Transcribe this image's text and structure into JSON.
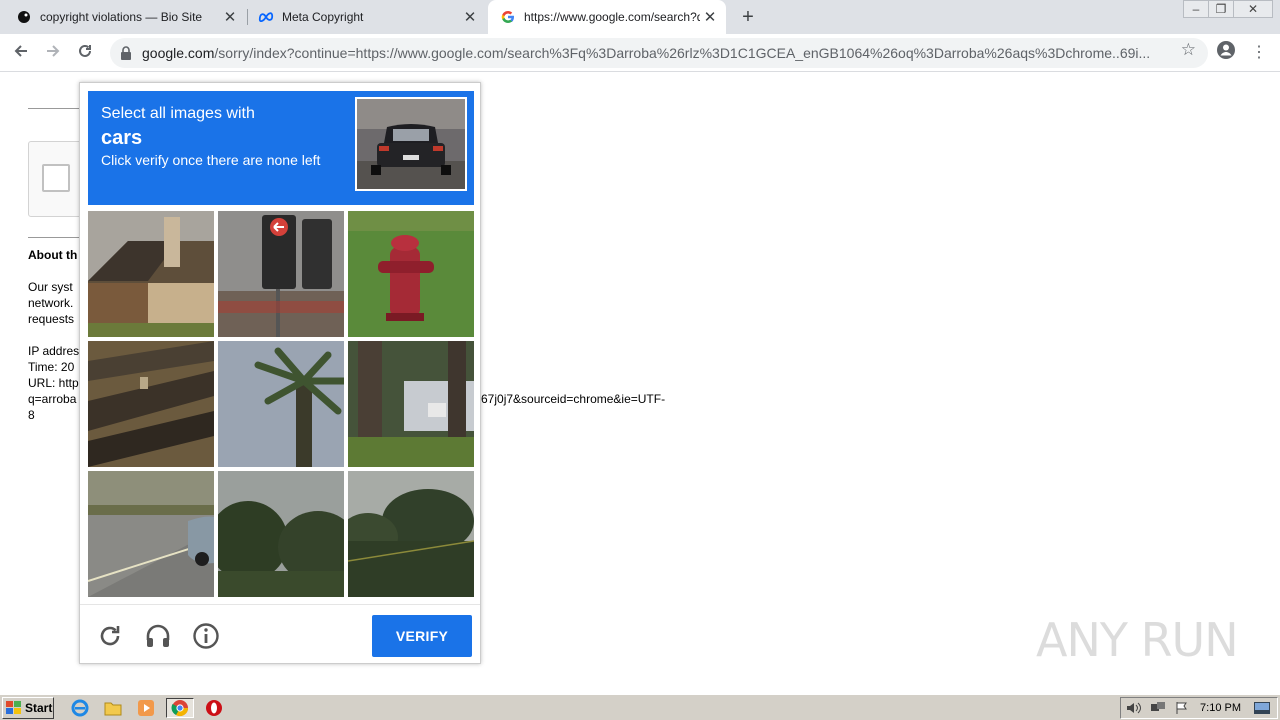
{
  "browser": {
    "tabs": [
      {
        "title": "copyright violations — Bio Site",
        "favicon": "bio-site-icon"
      },
      {
        "title": "Meta Copyright",
        "favicon": "meta-icon"
      },
      {
        "title": "https://www.google.com/search?q=",
        "favicon": "google-icon",
        "active": true
      }
    ],
    "url_host": "google.com",
    "url_path": "/sorry/index?continue=https://www.google.com/search%3Fq%3Darroba%26rlz%3D1C1GCEA_enGB1064%26oq%3Darroba%26aqs%3Dchrome..69i..."
  },
  "page": {
    "about_heading": "About th",
    "para_line1": "Our syst",
    "para_line2": "network.",
    "para_line3": "requests",
    "ip_label": "IP addres",
    "time_label": "Time: 20",
    "url_label": "URL: http",
    "url_line2_left": "q=arroba",
    "url_line2_right": "67j0j7&sourceid=chrome&ie=UTF-",
    "url_line3": "8"
  },
  "captcha": {
    "instruction": "Select all images with",
    "target": "cars",
    "subtext": "Click verify once there are none left",
    "tiles": [
      "house-roof",
      "traffic-light",
      "fire-hydrant",
      "roadside-shadow",
      "palm-tree",
      "tree-trunks",
      "road-with-car",
      "trees-dark",
      "trees-hill"
    ],
    "verify_label": "VERIFY"
  },
  "watermark": "ANY RUN",
  "taskbar": {
    "start_label": "Start",
    "clock": "7:10 PM"
  },
  "colors": {
    "accent": "#1a73e8",
    "taskbar": "#d4d0c8"
  }
}
